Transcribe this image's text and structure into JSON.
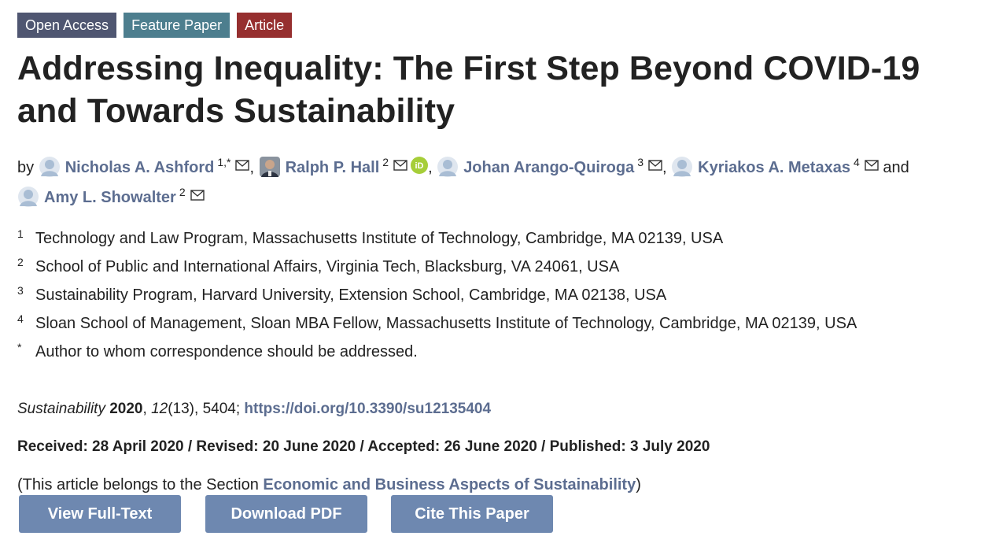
{
  "badges": {
    "open_access": "Open Access",
    "feature_paper": "Feature Paper",
    "article": "Article"
  },
  "title": {
    "line1": "Addressing Inequality: The First Step Beyond COVID-19",
    "line2": "and Towards Sustainability"
  },
  "authors": {
    "by": "by",
    "and": "and",
    "list": [
      {
        "name": "Nicholas A. Ashford",
        "sup": "1,*",
        "avatar": "person-placeholder-icon"
      },
      {
        "name": "Ralph P. Hall",
        "sup": "2",
        "avatar": "author-photo",
        "orcid": "iD"
      },
      {
        "name": "Johan Arango-Quiroga",
        "sup": "3",
        "avatar": "person-placeholder-icon"
      },
      {
        "name": "Kyriakos A. Metaxas",
        "sup": "4",
        "avatar": "person-placeholder-icon"
      },
      {
        "name": "Amy L. Showalter",
        "sup": "2",
        "avatar": "person-placeholder-icon"
      }
    ]
  },
  "affiliations": [
    {
      "num": "1",
      "text": "Technology and Law Program, Massachusetts Institute of Technology, Cambridge, MA 02139, USA"
    },
    {
      "num": "2",
      "text": "School of Public and International Affairs, Virginia Tech, Blacksburg, VA 24061, USA"
    },
    {
      "num": "3",
      "text": "Sustainability Program, Harvard University, Extension School, Cambridge, MA 02138, USA"
    },
    {
      "num": "4",
      "text": "Sloan School of Management, Sloan MBA Fellow, Massachusetts Institute of Technology, Cambridge, MA 02139, USA"
    },
    {
      "num": "*",
      "text": "Author to whom correspondence should be addressed."
    }
  ],
  "citation": {
    "journal": "Sustainability",
    "year": "2020",
    "volume": "12",
    "issue": "(13)",
    "article_no": ", 5404; ",
    "doi": "https://doi.org/10.3390/su12135404"
  },
  "dates": "Received: 28 April 2020 / Revised: 20 June 2020 / Accepted: 26 June 2020 / Published: 3 July 2020",
  "section": {
    "prefix": "(This article belongs to the Section ",
    "name": "Economic and Business Aspects of Sustainability",
    "suffix": ")"
  },
  "buttons": {
    "view_full_text": "View Full-Text",
    "download_pdf": "Download PDF",
    "cite_paper": "Cite This Paper"
  },
  "colors": {
    "link": "#5c6d90",
    "button": "#6e88b0",
    "badge_open": "#4f5671",
    "badge_feature": "#4d7e8e",
    "badge_article": "#962f2f"
  }
}
